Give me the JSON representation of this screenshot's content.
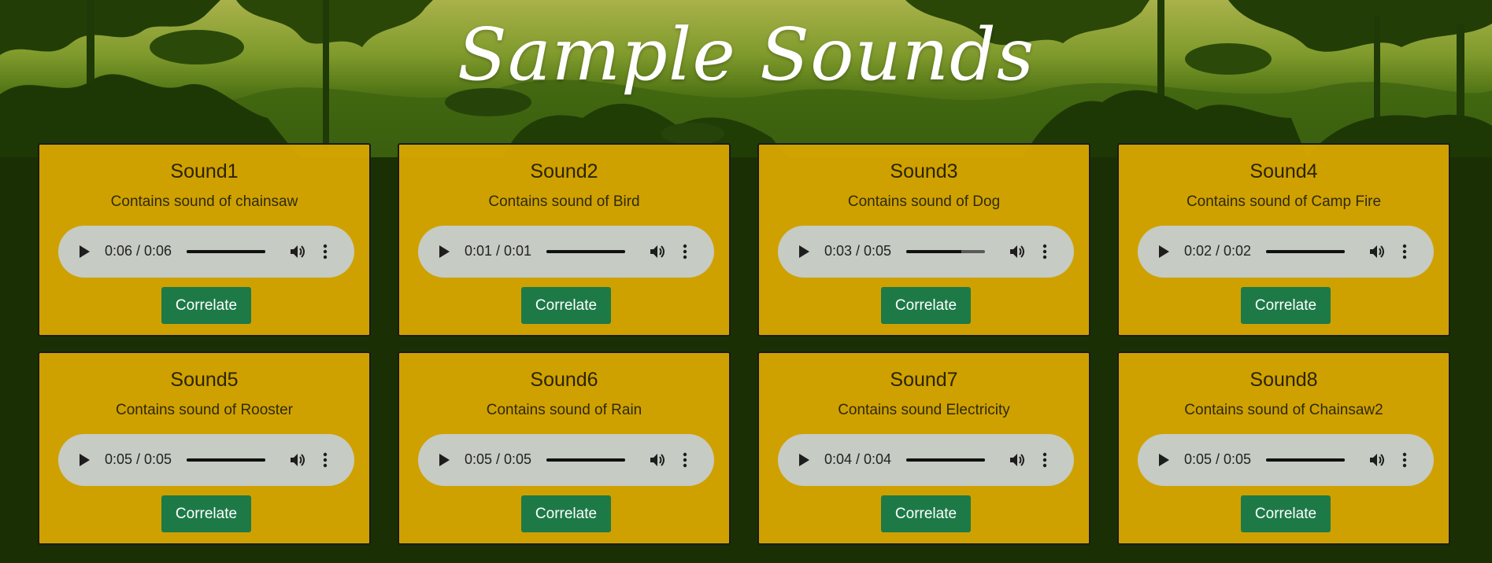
{
  "page": {
    "title": "Sample Sounds",
    "colors": {
      "background_dark": "#1a3004",
      "card": "#d6a500",
      "button": "#1d7a47",
      "player": "#c6cbc3"
    }
  },
  "sounds": [
    {
      "name": "Sound1",
      "description": "Contains sound of chainsaw",
      "time": "0:06 / 0:06",
      "progress": 1.0,
      "button_label": "Correlate"
    },
    {
      "name": "Sound2",
      "description": "Contains sound of Bird",
      "time": "0:01 / 0:01",
      "progress": 1.0,
      "button_label": "Correlate"
    },
    {
      "name": "Sound3",
      "description": "Contains sound of Dog",
      "time": "0:03 / 0:05",
      "progress": 0.7,
      "button_label": "Correlate"
    },
    {
      "name": "Sound4",
      "description": "Contains sound of Camp Fire",
      "time": "0:02 / 0:02",
      "progress": 1.0,
      "button_label": "Correlate"
    },
    {
      "name": "Sound5",
      "description": "Contains sound of Rooster",
      "time": "0:05 / 0:05",
      "progress": 1.0,
      "button_label": "Correlate"
    },
    {
      "name": "Sound6",
      "description": "Contains sound of Rain",
      "time": "0:05 / 0:05",
      "progress": 1.0,
      "button_label": "Correlate"
    },
    {
      "name": "Sound7",
      "description": "Contains sound Electricity",
      "time": "0:04 / 0:04",
      "progress": 1.0,
      "button_label": "Correlate"
    },
    {
      "name": "Sound8",
      "description": "Contains sound of Chainsaw2",
      "time": "0:05 / 0:05",
      "progress": 1.0,
      "button_label": "Correlate"
    }
  ],
  "icons": {
    "play": "play-icon",
    "volume": "volume-icon",
    "more": "more-options-icon"
  }
}
